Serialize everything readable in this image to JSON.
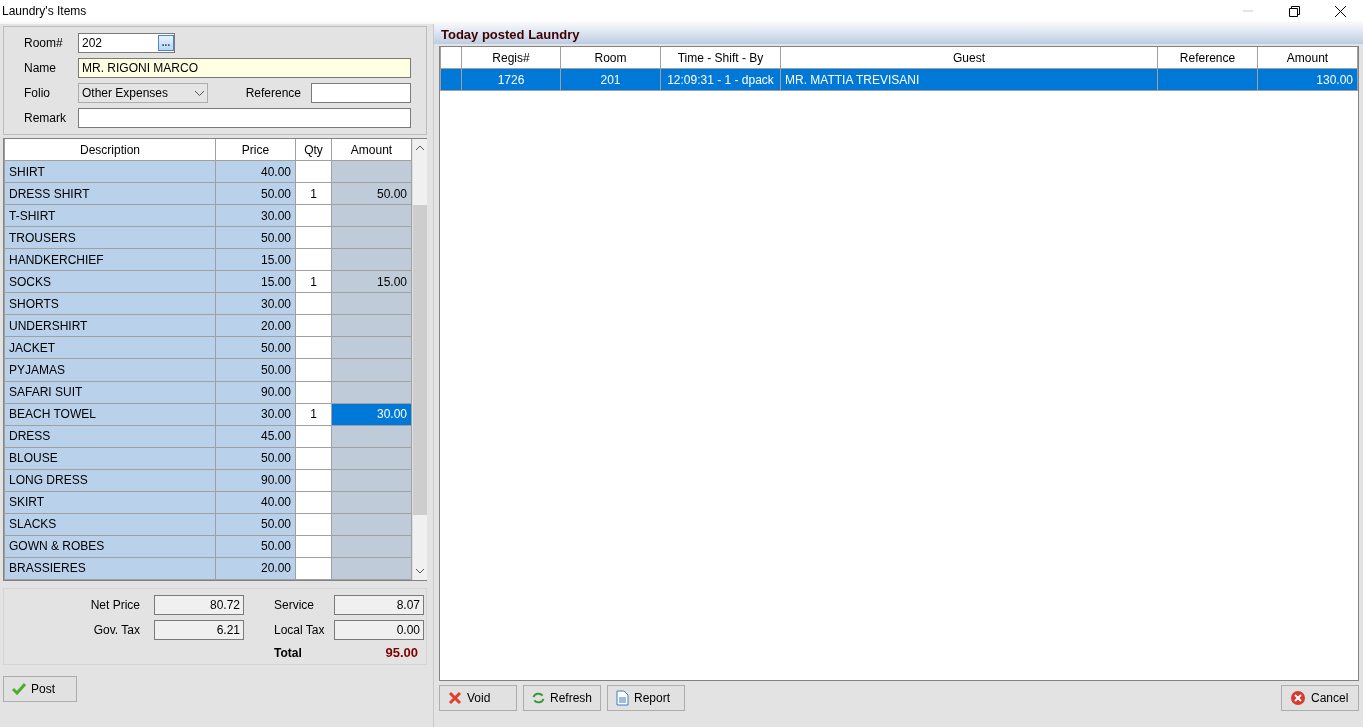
{
  "window": {
    "title": "Laundry's Items",
    "minimize_disabled": true
  },
  "form": {
    "room_label": "Room#",
    "room": "202",
    "room_lookup": "...",
    "name_label": "Name",
    "name": "MR. RIGONI MARCO",
    "folio_label": "Folio",
    "folio": "Other Expenses",
    "reference_label": "Reference",
    "remark_label": "Remark"
  },
  "items": {
    "columns": [
      "Description",
      "Price",
      "Qty",
      "Amount"
    ],
    "rows": [
      {
        "description": "SHIRT",
        "price": "40.00",
        "selected": false
      },
      {
        "description": "DRESS SHIRT",
        "price": "50.00",
        "qty": "1",
        "amount": "50.00",
        "selected": false
      },
      {
        "description": "T-SHIRT",
        "price": "30.00",
        "selected": false
      },
      {
        "description": "TROUSERS",
        "price": "50.00",
        "selected": false
      },
      {
        "description": "HANDKERCHIEF",
        "price": "15.00",
        "selected": false
      },
      {
        "description": "SOCKS",
        "price": "15.00",
        "qty": "1",
        "amount": "15.00",
        "selected": false
      },
      {
        "description": "SHORTS",
        "price": "30.00",
        "selected": false
      },
      {
        "description": "UNDERSHIRT",
        "price": "20.00",
        "selected": false
      },
      {
        "description": "JACKET",
        "price": "50.00",
        "selected": false
      },
      {
        "description": "PYJAMAS",
        "price": "50.00",
        "selected": false
      },
      {
        "description": "SAFARI SUIT",
        "price": "90.00",
        "selected": false
      },
      {
        "description": "BEACH TOWEL",
        "price": "30.00",
        "qty": "1",
        "amount": "30.00",
        "selected": true
      },
      {
        "description": "DRESS",
        "price": "45.00",
        "selected": false
      },
      {
        "description": "BLOUSE",
        "price": "50.00",
        "selected": false
      },
      {
        "description": "LONG DRESS",
        "price": "90.00",
        "selected": false
      },
      {
        "description": "SKIRT",
        "price": "40.00",
        "selected": false
      },
      {
        "description": "SLACKS",
        "price": "50.00",
        "selected": false
      },
      {
        "description": "GOWN & ROBES",
        "price": "50.00",
        "selected": false
      },
      {
        "description": "BRASSIERES",
        "price": "20.00",
        "selected": false
      }
    ]
  },
  "totals": {
    "net_price_label": "Net Price",
    "net_price": "80.72",
    "service_label": "Service",
    "service": "8.07",
    "gov_tax_label": "Gov. Tax",
    "gov_tax": "6.21",
    "local_tax_label": "Local Tax",
    "local_tax": "0.00",
    "total_label": "Total",
    "total": "95.00"
  },
  "post_button": "Post",
  "posted": {
    "title": "Today posted Laundry",
    "columns": [
      "Regis#",
      "Room",
      "Time - Shift - By",
      "Guest",
      "Reference",
      "Amount"
    ],
    "rows": [
      {
        "regis": "1726",
        "room": "201",
        "time_shift_by": "12:09:31 - 1 - dpack",
        "guest": "MR. MATTIA TREVISANI",
        "amount": "130.00",
        "selected": true
      }
    ]
  },
  "buttons": [
    {
      "kind": "void",
      "label": "Void"
    },
    {
      "kind": "refresh",
      "label": "Refresh"
    },
    {
      "kind": "report",
      "label": "Report"
    },
    {
      "kind": "cancel",
      "label": "Cancel"
    }
  ]
}
